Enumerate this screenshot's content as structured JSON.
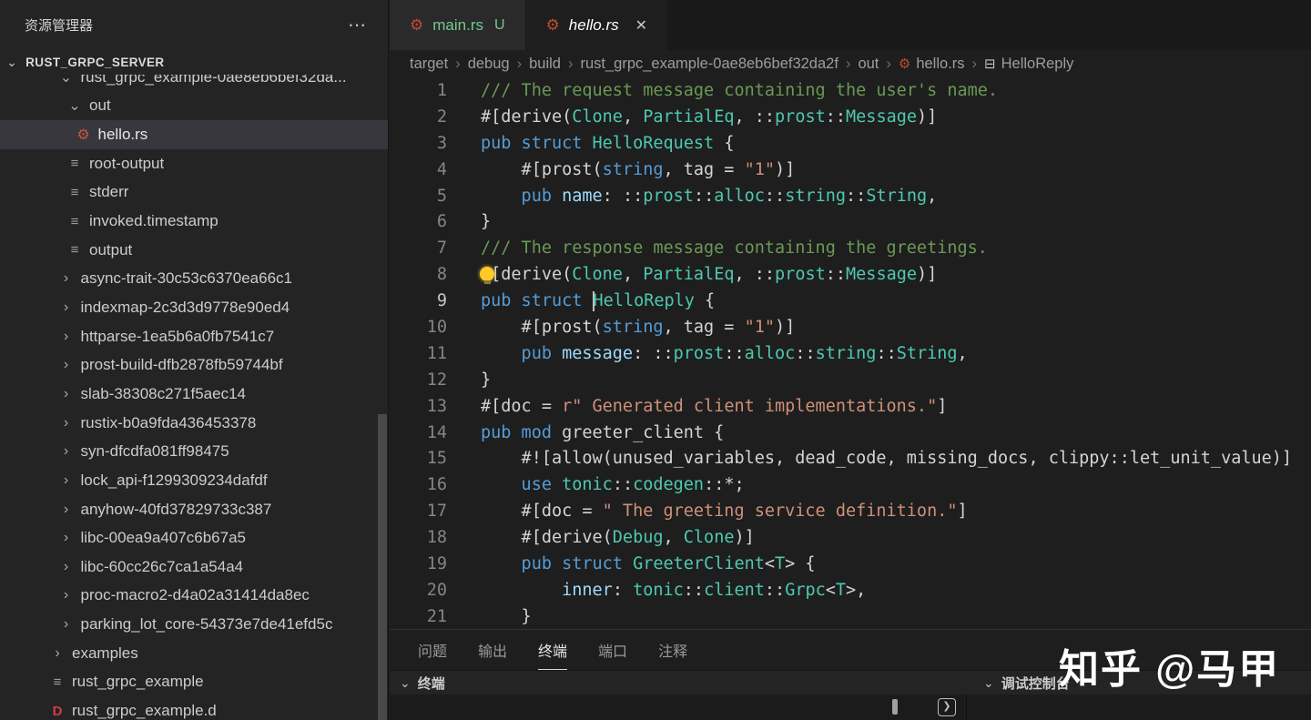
{
  "icons": {
    "chevron_down": "⌄",
    "chevron_right": "›",
    "more": "⋯",
    "close": "✕",
    "gear": "⚙",
    "file": "≡",
    "d_letter": "D",
    "struct_symbol": "⊟",
    "breadcrumb_sep": "›",
    "terminal_prompt": "❯"
  },
  "colors": {
    "comment": "#6a9955",
    "keyword": "#569cd6",
    "type": "#4ec9b0",
    "string": "#ce9178",
    "variable": "#9cdcfe",
    "plain": "#d4d4d4",
    "git_untracked": "#73c991",
    "selection_bg": "#37373d",
    "lightbulb": "#ffca28"
  },
  "sidebar": {
    "title": "资源管理器",
    "section": {
      "label": "RUST_GRPC_SERVER",
      "expanded": true
    },
    "tree": [
      {
        "label": "rust_grpc_example-0ae8eb6bef32da...",
        "kind": "folder",
        "expanded": true,
        "level": 1
      },
      {
        "label": "out",
        "kind": "folder",
        "expanded": true,
        "level": 2
      },
      {
        "label": "hello.rs",
        "kind": "rust",
        "level": 3,
        "selected": true
      },
      {
        "label": "root-output",
        "kind": "file",
        "level": 2
      },
      {
        "label": "stderr",
        "kind": "file",
        "level": 2
      },
      {
        "label": "invoked.timestamp",
        "kind": "file",
        "level": 2
      },
      {
        "label": "output",
        "kind": "file",
        "level": 2
      },
      {
        "label": "async-trait-30c53c6370ea66c1",
        "kind": "folder",
        "expanded": false,
        "level": 1
      },
      {
        "label": "indexmap-2c3d3d9778e90ed4",
        "kind": "folder",
        "expanded": false,
        "level": 1
      },
      {
        "label": "httparse-1ea5b6a0fb7541c7",
        "kind": "folder",
        "expanded": false,
        "level": 1
      },
      {
        "label": "prost-build-dfb2878fb59744bf",
        "kind": "folder",
        "expanded": false,
        "level": 1
      },
      {
        "label": "slab-38308c271f5aec14",
        "kind": "folder",
        "expanded": false,
        "level": 1
      },
      {
        "label": "rustix-b0a9fda436453378",
        "kind": "folder",
        "expanded": false,
        "level": 1
      },
      {
        "label": "syn-dfcdfa081ff98475",
        "kind": "folder",
        "expanded": false,
        "level": 1
      },
      {
        "label": "lock_api-f1299309234dafdf",
        "kind": "folder",
        "expanded": false,
        "level": 1
      },
      {
        "label": "anyhow-40fd37829733c387",
        "kind": "folder",
        "expanded": false,
        "level": 1
      },
      {
        "label": "libc-00ea9a407c6b67a5",
        "kind": "folder",
        "expanded": false,
        "level": 1
      },
      {
        "label": "libc-60cc26c7ca1a54a4",
        "kind": "folder",
        "expanded": false,
        "level": 1
      },
      {
        "label": "proc-macro2-d4a02a31414da8ec",
        "kind": "folder",
        "expanded": false,
        "level": 1
      },
      {
        "label": "parking_lot_core-54373e7de41efd5c",
        "kind": "folder",
        "expanded": false,
        "level": 1
      },
      {
        "label": "examples",
        "kind": "folder",
        "expanded": false,
        "level": 0
      },
      {
        "label": "rust_grpc_example",
        "kind": "file",
        "level": 0
      },
      {
        "label": "rust_grpc_example.d",
        "kind": "dfile",
        "level": 0
      }
    ]
  },
  "editor": {
    "tabs": [
      {
        "label": "main.rs",
        "icon": "rust",
        "untracked": true,
        "badge": "U",
        "active": false,
        "italic": false,
        "close": false
      },
      {
        "label": "hello.rs",
        "icon": "rust",
        "untracked": false,
        "badge": "",
        "active": true,
        "italic": true,
        "close": true
      }
    ],
    "breadcrumbs": [
      {
        "label": "target"
      },
      {
        "label": "debug"
      },
      {
        "label": "build"
      },
      {
        "label": "rust_grpc_example-0ae8eb6bef32da2f"
      },
      {
        "label": "out"
      },
      {
        "label": "hello.rs",
        "icon": "rust"
      },
      {
        "label": "HelloReply",
        "icon": "symbol"
      }
    ],
    "active_line": 9,
    "lightbulb_line": 8,
    "lines": [
      [
        [
          "cm",
          "/// The request message containing the user's name."
        ]
      ],
      [
        [
          "pl",
          "#[derive("
        ],
        [
          "ty",
          "Clone"
        ],
        [
          "pl",
          ", "
        ],
        [
          "ty",
          "PartialEq"
        ],
        [
          "pl",
          ", ::"
        ],
        [
          "ty",
          "prost"
        ],
        [
          "pl",
          "::"
        ],
        [
          "ty",
          "Message"
        ],
        [
          "pl",
          ")]"
        ]
      ],
      [
        [
          "kw",
          "pub struct "
        ],
        [
          "ty",
          "HelloRequest"
        ],
        [
          "pl",
          " {"
        ]
      ],
      [
        [
          "pl",
          "    #[prost("
        ],
        [
          "kw",
          "string"
        ],
        [
          "pl",
          ", tag = "
        ],
        [
          "st",
          "\"1\""
        ],
        [
          "pl",
          ")]"
        ]
      ],
      [
        [
          "kw",
          "    pub "
        ],
        [
          "va",
          "name"
        ],
        [
          "pl",
          ": ::"
        ],
        [
          "ty",
          "prost"
        ],
        [
          "pl",
          "::"
        ],
        [
          "ty",
          "alloc"
        ],
        [
          "pl",
          "::"
        ],
        [
          "ty",
          "string"
        ],
        [
          "pl",
          "::"
        ],
        [
          "ty",
          "String"
        ],
        [
          "pl",
          ","
        ]
      ],
      [
        [
          "pl",
          "}"
        ]
      ],
      [
        [
          "cm",
          "/// The response message containing the greetings."
        ]
      ],
      [
        [
          "pl",
          "#[derive("
        ],
        [
          "ty",
          "Clone"
        ],
        [
          "pl",
          ", "
        ],
        [
          "ty",
          "PartialEq"
        ],
        [
          "pl",
          ", ::"
        ],
        [
          "ty",
          "prost"
        ],
        [
          "pl",
          "::"
        ],
        [
          "ty",
          "Message"
        ],
        [
          "pl",
          ")]"
        ]
      ],
      [
        [
          "kw",
          "pub struct "
        ],
        [
          "cur",
          ""
        ],
        [
          "ty",
          "HelloReply"
        ],
        [
          "pl",
          " {"
        ]
      ],
      [
        [
          "pl",
          "    #[prost("
        ],
        [
          "kw",
          "string"
        ],
        [
          "pl",
          ", tag = "
        ],
        [
          "st",
          "\"1\""
        ],
        [
          "pl",
          ")]"
        ]
      ],
      [
        [
          "kw",
          "    pub "
        ],
        [
          "va",
          "message"
        ],
        [
          "pl",
          ": ::"
        ],
        [
          "ty",
          "prost"
        ],
        [
          "pl",
          "::"
        ],
        [
          "ty",
          "alloc"
        ],
        [
          "pl",
          "::"
        ],
        [
          "ty",
          "string"
        ],
        [
          "pl",
          "::"
        ],
        [
          "ty",
          "String"
        ],
        [
          "pl",
          ","
        ]
      ],
      [
        [
          "pl",
          "}"
        ]
      ],
      [
        [
          "pl",
          "#[doc = "
        ],
        [
          "st",
          "r\" Generated client implementations.\""
        ],
        [
          "pl",
          "]"
        ]
      ],
      [
        [
          "kw",
          "pub mod "
        ],
        [
          "pl",
          "greeter_client {"
        ]
      ],
      [
        [
          "pl",
          "    #![allow(unused_variables, dead_code, missing_docs, clippy::let_unit_value)]"
        ]
      ],
      [
        [
          "kw",
          "    use "
        ],
        [
          "ty",
          "tonic"
        ],
        [
          "pl",
          "::"
        ],
        [
          "ty",
          "codegen"
        ],
        [
          "pl",
          "::*;"
        ]
      ],
      [
        [
          "pl",
          "    #[doc = "
        ],
        [
          "st",
          "\" The greeting service definition.\""
        ],
        [
          "pl",
          "]"
        ]
      ],
      [
        [
          "pl",
          "    #[derive("
        ],
        [
          "ty",
          "Debug"
        ],
        [
          "pl",
          ", "
        ],
        [
          "ty",
          "Clone"
        ],
        [
          "pl",
          ")]"
        ]
      ],
      [
        [
          "kw",
          "    pub struct "
        ],
        [
          "ty",
          "GreeterClient"
        ],
        [
          "pl",
          "<"
        ],
        [
          "ty",
          "T"
        ],
        [
          "pl",
          "> {"
        ]
      ],
      [
        [
          "pl",
          "        "
        ],
        [
          "va",
          "inner"
        ],
        [
          "pl",
          ": "
        ],
        [
          "ty",
          "tonic"
        ],
        [
          "pl",
          "::"
        ],
        [
          "ty",
          "client"
        ],
        [
          "pl",
          "::"
        ],
        [
          "ty",
          "Grpc"
        ],
        [
          "pl",
          "<"
        ],
        [
          "ty",
          "T"
        ],
        [
          "pl",
          ">,"
        ]
      ],
      [
        [
          "pl",
          "    }"
        ]
      ]
    ]
  },
  "panel": {
    "tabs": [
      {
        "key": "problems",
        "label": "问题",
        "active": false
      },
      {
        "key": "output",
        "label": "输出",
        "active": false
      },
      {
        "key": "terminal",
        "label": "终端",
        "active": true
      },
      {
        "key": "ports",
        "label": "端口",
        "active": false
      },
      {
        "key": "comments",
        "label": "注释",
        "active": false
      }
    ],
    "terminal_header": "终端",
    "debug_console_header": "调试控制台"
  },
  "watermark": "知乎 @马甲"
}
